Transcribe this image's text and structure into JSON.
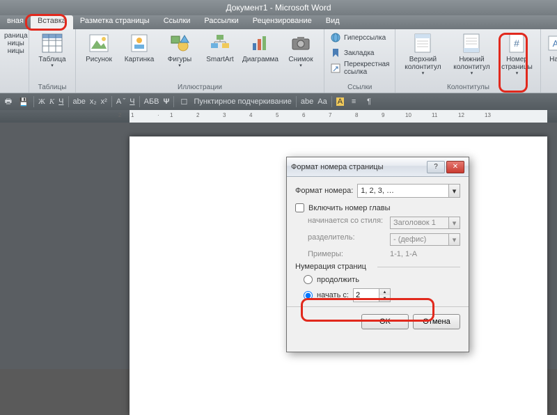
{
  "title": "Документ1 - Microsoft Word",
  "tabs": [
    "вная",
    "Вставка",
    "Разметка страницы",
    "Ссылки",
    "Рассылки",
    "Рецензирование",
    "Вид"
  ],
  "activeTab": 1,
  "groups": {
    "pages": {
      "label": "",
      "btn": {
        "l1": "раница",
        "l2": "ницы",
        "l3": "ницы"
      }
    },
    "tables": {
      "label": "Таблицы",
      "btn": "Таблица"
    },
    "illus": {
      "label": "Иллюстрации",
      "btns": [
        "Рисунок",
        "Картинка",
        "Фигуры",
        "SmartArt",
        "Диаграмма",
        "Снимок"
      ]
    },
    "links": {
      "label": "Ссылки",
      "btns": [
        "Гиперссылка",
        "Закладка",
        "Перекрестная ссылка"
      ]
    },
    "hdrftr": {
      "label": "Колонтитулы",
      "btns": [
        "Верхний колонтитул",
        "Нижний колонтитул",
        "Номер страницы"
      ]
    },
    "text": {
      "btn": "Над"
    }
  },
  "quickbar": {
    "style": "Пунктирное подчеркивание"
  },
  "dialog": {
    "title": "Формат номера страницы",
    "formatLabel": "Формат номера:",
    "formatValue": "1, 2, 3, …",
    "includeChapter": "Включить номер главы",
    "startStyle": {
      "lab": "начинается со стиля:",
      "val": "Заголовок 1"
    },
    "separator": {
      "lab": "разделитель:",
      "val": "-   (дефис)"
    },
    "examples": {
      "lab": "Примеры:",
      "val": "1-1, 1-A"
    },
    "numberingHdr": "Нумерация страниц",
    "continue": "продолжить",
    "startAt": "начать с:",
    "startValue": "2",
    "ok": "OK",
    "cancel": "Отмена"
  }
}
